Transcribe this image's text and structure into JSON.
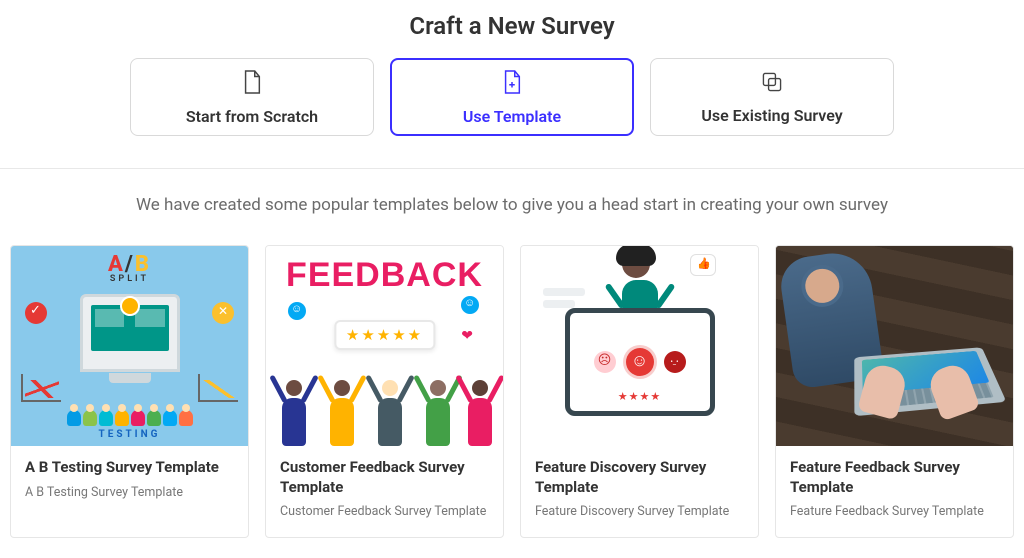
{
  "page_title": "Craft a New Survey",
  "options": {
    "scratch": {
      "label": "Start from Scratch"
    },
    "template": {
      "label": "Use Template"
    },
    "existing": {
      "label": "Use Existing Survey"
    }
  },
  "selected_option": "template",
  "subtitle": "We have created some popular templates below to give you a head start in creating your own survey",
  "templates": [
    {
      "title": "A B Testing Survey Template",
      "desc": "A B Testing Survey Template"
    },
    {
      "title": "Customer Feedback Survey Template",
      "desc": "Customer Feedback Survey Template"
    },
    {
      "title": "Feature Discovery Survey Template",
      "desc": "Feature Discovery Survey Template"
    },
    {
      "title": "Feature Feedback Survey Template",
      "desc": "Feature Feedback Survey Template"
    }
  ],
  "thumb_text": {
    "ab_a": "A",
    "ab_slash": "/",
    "ab_b": "B",
    "ab_split": "SPLIT",
    "ab_testing": "TESTING",
    "fb_word": "FEEDBACK",
    "fb_stars": "★★★★★",
    "fd_stars": "★★★★"
  }
}
